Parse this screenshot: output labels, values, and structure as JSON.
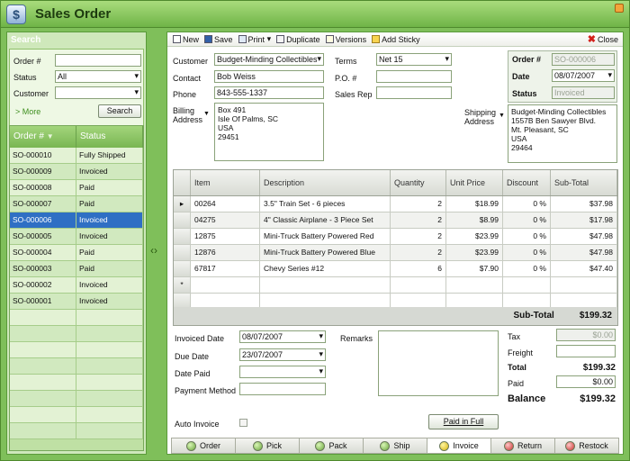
{
  "window": {
    "title": "Sales Order"
  },
  "search": {
    "heading": "Search",
    "order_label": "Order #",
    "order_value": "",
    "status_label": "Status",
    "status_value": "All",
    "customer_label": "Customer",
    "customer_value": "",
    "more_label": "> More",
    "search_button": "Search"
  },
  "order_list": {
    "columns": [
      "Order #",
      "Status"
    ],
    "rows": [
      {
        "order": "SO-000010",
        "status": "Fully Shipped"
      },
      {
        "order": "SO-000009",
        "status": "Invoiced"
      },
      {
        "order": "SO-000008",
        "status": "Paid"
      },
      {
        "order": "SO-000007",
        "status": "Paid"
      },
      {
        "order": "SO-000006",
        "status": "Invoiced",
        "selected": true
      },
      {
        "order": "SO-000005",
        "status": "Invoiced"
      },
      {
        "order": "SO-000004",
        "status": "Paid"
      },
      {
        "order": "SO-000003",
        "status": "Paid"
      },
      {
        "order": "SO-000002",
        "status": "Invoiced"
      },
      {
        "order": "SO-000001",
        "status": "Invoiced"
      }
    ]
  },
  "toolbar": {
    "new": "New",
    "save": "Save",
    "print": "Print",
    "duplicate": "Duplicate",
    "versions": "Versions",
    "add_sticky": "Add Sticky",
    "close": "Close"
  },
  "header": {
    "customer_label": "Customer",
    "customer_value": "Budget-Minding Collectibles",
    "contact_label": "Contact",
    "contact_value": "Bob Weiss",
    "phone_label": "Phone",
    "phone_value": "843-555-1337",
    "billing_label": "Billing Address",
    "billing_value": "Box 491\nIsle Of Palms,  SC\nUSA\n29451",
    "terms_label": "Terms",
    "terms_value": "Net 15",
    "po_label": "P.O. #",
    "po_value": "",
    "salesrep_label": "Sales Rep",
    "salesrep_value": "",
    "shipping_label": "Shipping Address",
    "shipping_value": "Budget-Minding Collectibles\n1557B Ben Sawyer Blvd.\nMt. Pleasant,  SC\nUSA\n29464",
    "order_label": "Order #",
    "order_value": "SO-000006",
    "date_label": "Date",
    "date_value": "08/07/2007",
    "status_label": "Status",
    "status_value": "Invoiced"
  },
  "items": {
    "columns": [
      "Item",
      "Description",
      "Quantity",
      "Unit Price",
      "Discount",
      "Sub-Total"
    ],
    "rows": [
      {
        "item": "00264",
        "description": "3.5\" Train Set - 6 pieces",
        "quantity": "2",
        "unit_price": "$18.99",
        "discount": "0 %",
        "subtotal": "$37.98"
      },
      {
        "item": "04275",
        "description": "4\" Classic Airplane - 3 Piece Set",
        "quantity": "2",
        "unit_price": "$8.99",
        "discount": "0 %",
        "subtotal": "$17.98"
      },
      {
        "item": "12875",
        "description": "Mini-Truck Battery Powered Red",
        "quantity": "2",
        "unit_price": "$23.99",
        "discount": "0 %",
        "subtotal": "$47.98"
      },
      {
        "item": "12876",
        "description": "Mini-Truck Battery Powered Blue",
        "quantity": "2",
        "unit_price": "$23.99",
        "discount": "0 %",
        "subtotal": "$47.98"
      },
      {
        "item": "67817",
        "description": "Chevy Series #12",
        "quantity": "6",
        "unit_price": "$7.90",
        "discount": "0 %",
        "subtotal": "$47.40"
      }
    ],
    "new_row_marker": "*",
    "subtotal_label": "Sub-Total",
    "subtotal_value": "$199.32"
  },
  "footer": {
    "invoiced_date_label": "Invoiced Date",
    "invoiced_date_value": "08/07/2007",
    "due_date_label": "Due Date",
    "due_date_value": "23/07/2007",
    "date_paid_label": "Date Paid",
    "date_paid_value": "",
    "payment_method_label": "Payment Method",
    "payment_method_value": "",
    "remarks_label": "Remarks",
    "auto_invoice_label": "Auto Invoice",
    "paid_in_full_button": "Paid in Full",
    "tax_label": "Tax",
    "tax_value": "$0.00",
    "freight_label": "Freight",
    "freight_value": "",
    "total_label": "Total",
    "total_value": "$199.32",
    "paid_label": "Paid",
    "paid_value": "$0.00",
    "balance_label": "Balance",
    "balance_value": "$199.32"
  },
  "tabs": [
    {
      "label": "Order",
      "color": "green"
    },
    {
      "label": "Pick",
      "color": "green"
    },
    {
      "label": "Pack",
      "color": "green"
    },
    {
      "label": "Ship",
      "color": "green"
    },
    {
      "label": "Invoice",
      "color": "yellow",
      "active": true
    },
    {
      "label": "Return",
      "color": "red"
    },
    {
      "label": "Restock",
      "color": "red"
    }
  ]
}
